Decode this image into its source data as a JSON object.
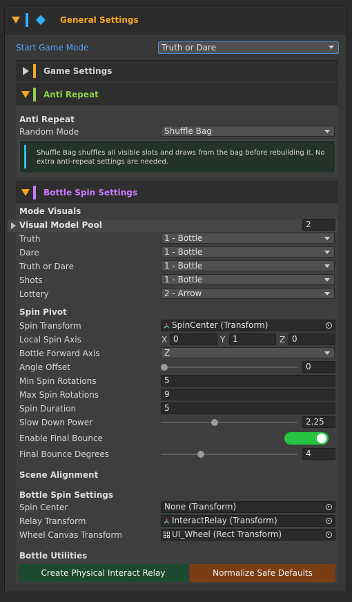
{
  "header": {
    "title": "General Settings"
  },
  "start_mode": {
    "label": "Start Game Mode",
    "value": "Truth or Dare"
  },
  "sections": {
    "game_settings": "Game Settings",
    "anti_repeat": "Anti Repeat",
    "bottle_spin": "Bottle Spin Settings"
  },
  "anti_repeat": {
    "heading": "Anti Repeat",
    "random_mode_label": "Random Mode",
    "random_mode_value": "Shuffle Bag",
    "help_line1": "Shuffle Bag shuffles all visible slots and draws from the bag before rebuilding it. No",
    "help_line2": "extra anti-repeat settings are needed."
  },
  "mode_visuals": {
    "heading": "Mode Visuals",
    "pool_label": "Visual Model Pool",
    "pool_count": "2",
    "rows": [
      {
        "label": "Truth",
        "value": "1 - Bottle"
      },
      {
        "label": "Dare",
        "value": "1 - Bottle"
      },
      {
        "label": "Truth or Dare",
        "value": "1 - Bottle"
      },
      {
        "label": "Shots",
        "value": "1 - Bottle"
      },
      {
        "label": "Lottery",
        "value": "2 - Arrow"
      }
    ]
  },
  "spin_pivot": {
    "heading": "Spin Pivot",
    "spin_transform_label": "Spin Transform",
    "spin_transform_value": "SpinCenter (Transform)",
    "local_axis_label": "Local Spin Axis",
    "x_label": "X",
    "x_value": "0",
    "y_label": "Y",
    "y_value": "1",
    "z_label": "Z",
    "z_value": "0",
    "forward_axis_label": "Bottle Forward Axis",
    "forward_axis_value": "Z",
    "angle_offset_label": "Angle Offset",
    "angle_offset_value": "0",
    "angle_offset_fraction": 0.0,
    "min_rot_label": "Min Spin Rotations",
    "min_rot_value": "5",
    "max_rot_label": "Max Spin Rotations",
    "max_rot_value": "9",
    "duration_label": "Spin Duration",
    "duration_value": "5",
    "slow_power_label": "Slow Down Power",
    "slow_power_value": "2.25",
    "slow_power_fraction": 0.39,
    "bounce_label": "Enable Final Bounce",
    "bounce_enabled": true,
    "bounce_deg_label": "Final Bounce Degrees",
    "bounce_deg_value": "4",
    "bounce_deg_fraction": 0.28
  },
  "scene_alignment": {
    "heading": "Scene Alignment"
  },
  "bottle_spin_refs": {
    "heading": "Bottle Spin Settings",
    "spin_center_label": "Spin Center",
    "spin_center_value": "None (Transform)",
    "relay_label": "Relay Transform",
    "relay_value": "InteractRelay (Transform)",
    "wheel_label": "Wheel Canvas Transform",
    "wheel_value": "UI_Wheel (Rect Transform)"
  },
  "utilities": {
    "heading": "Bottle Utilities",
    "create_button": "Create Physical Interact Relay",
    "normalize_button": "Normalize Safe Defaults"
  },
  "colors": {
    "orange": "#f5a623",
    "green": "#8ed04a",
    "purple": "#c77dff",
    "cyan": "#2fb0ff",
    "toggle_on": "#26c443",
    "create_btn": "#1c4a31",
    "normalize_btn": "#7a3d14"
  }
}
